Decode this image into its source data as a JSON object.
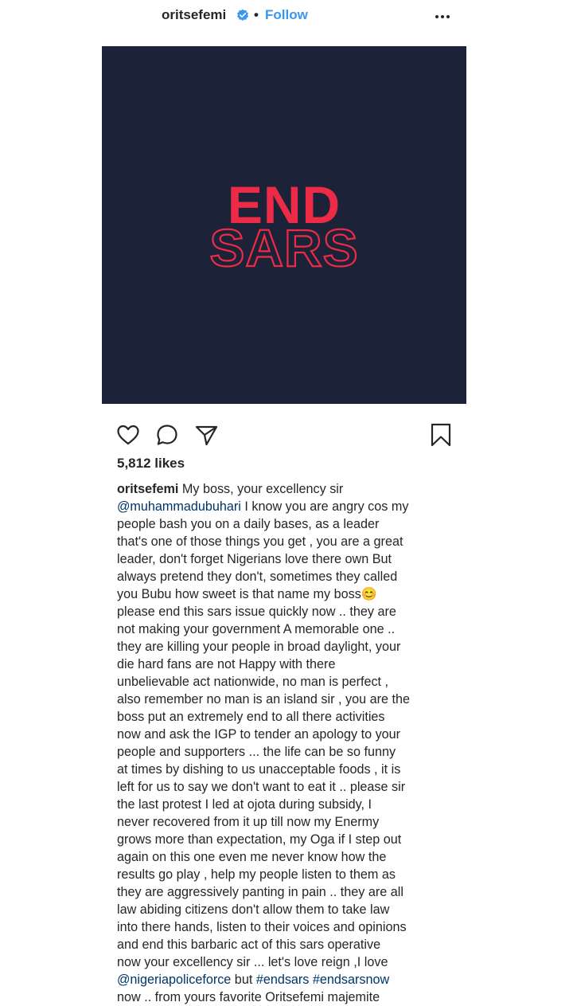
{
  "header": {
    "username": "oritsefemi",
    "separator": "•",
    "follow_label": "Follow"
  },
  "post_image": {
    "line1": "END",
    "line2": "SARS",
    "background": "#1c2237",
    "accent": "#ee2b47"
  },
  "actions": {
    "icons": [
      "heart-icon",
      "comment-icon",
      "share-icon",
      "bookmark-icon"
    ]
  },
  "likes": "5,812 likes",
  "caption": {
    "username": "oritsefemi",
    "lines": [
      [
        {
          "t": " My boss, your excellency sir",
          "k": "text"
        }
      ],
      [
        {
          "t": "@muhammadubuhari",
          "k": "tag"
        },
        {
          "t": " I know you are angry cos my",
          "k": "text"
        }
      ],
      [
        {
          "t": "people bash you on a daily bases, as a leader",
          "k": "text"
        }
      ],
      [
        {
          "t": "that's one of those things you get , you are a great",
          "k": "text"
        }
      ],
      [
        {
          "t": "leader, don't forget Nigerians love there own But",
          "k": "text"
        }
      ],
      [
        {
          "t": "always pretend they don't, sometimes they called",
          "k": "text"
        }
      ],
      [
        {
          "t": "you Bubu how sweet is that name my boss😊",
          "k": "text"
        }
      ],
      [
        {
          "t": "please end this sars issue quickly now .. they are",
          "k": "text"
        }
      ],
      [
        {
          "t": "not making your government A memorable one ..",
          "k": "text"
        }
      ],
      [
        {
          "t": "they are killing your people in broad daylight, your",
          "k": "text"
        }
      ],
      [
        {
          "t": "die hard fans are not Happy with there",
          "k": "text"
        }
      ],
      [
        {
          "t": "unbelievable act nationwide, no man is perfect ,",
          "k": "text"
        }
      ],
      [
        {
          "t": "also remember no man is an island sir , you are the",
          "k": "text"
        }
      ],
      [
        {
          "t": "boss put an extremely end to all there activities",
          "k": "text"
        }
      ],
      [
        {
          "t": "now and ask the IGP to tender an apology to your",
          "k": "text"
        }
      ],
      [
        {
          "t": "people and supporters ... the life can be so funny",
          "k": "text"
        }
      ],
      [
        {
          "t": "at times by dishing to us unacceptable foods , it is",
          "k": "text"
        }
      ],
      [
        {
          "t": "left for us to say we don't want to eat it .. please sir",
          "k": "text"
        }
      ],
      [
        {
          "t": "the last protest I led at ojota during subsidy, I",
          "k": "text"
        }
      ],
      [
        {
          "t": "never recovered from it up till now my Enermy",
          "k": "text"
        }
      ],
      [
        {
          "t": "grows more than expectation, my Oga if I step out",
          "k": "text"
        }
      ],
      [
        {
          "t": "again on this one even me never know how the",
          "k": "text"
        }
      ],
      [
        {
          "t": "results go play , help my people listen to them as",
          "k": "text"
        }
      ],
      [
        {
          "t": "they are aggressively panting in pain .. they are all",
          "k": "text"
        }
      ],
      [
        {
          "t": "law abiding citizens don't allow them to take law",
          "k": "text"
        }
      ],
      [
        {
          "t": "into there hands, listen to their voices and opinions",
          "k": "text"
        }
      ],
      [
        {
          "t": "and end this barbaric act of this sars operative",
          "k": "text"
        }
      ],
      [
        {
          "t": "now your excellency sir ... let's love reign ,I love",
          "k": "text"
        }
      ],
      [
        {
          "t": "@nigeriapoliceforce",
          "k": "tag"
        },
        {
          "t": " but ",
          "k": "text"
        },
        {
          "t": "#endsars",
          "k": "tag"
        },
        {
          "t": " ",
          "k": "text"
        },
        {
          "t": "#endsarsnow",
          "k": "tag"
        }
      ],
      [
        {
          "t": "now .. from yours favorite Oritsefemi majemite",
          "k": "text"
        }
      ]
    ]
  },
  "colors": {
    "link": "#3897f0",
    "tag": "#003569",
    "text": "#262626"
  }
}
